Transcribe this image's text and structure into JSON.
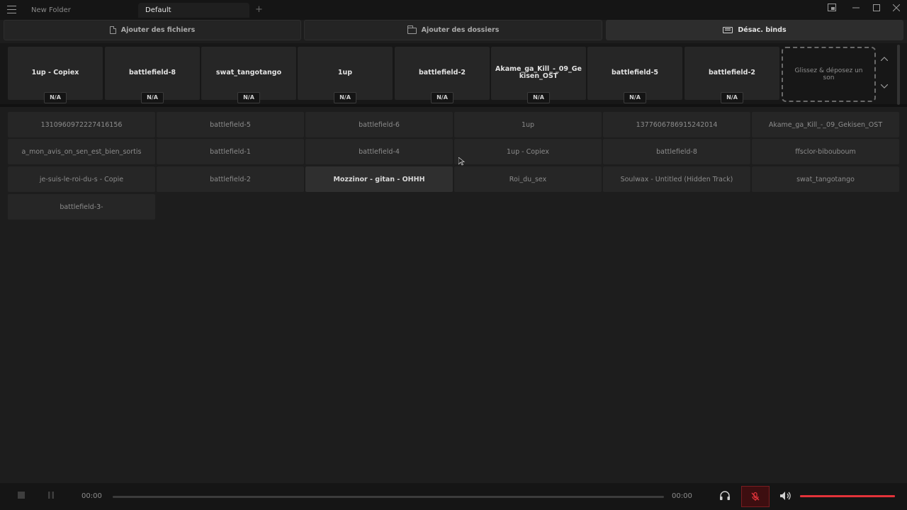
{
  "tabs": [
    {
      "label": "New Folder"
    },
    {
      "label": "Default"
    }
  ],
  "tab_add": "+",
  "actions": {
    "add_files": "Ajouter des fichiers",
    "add_folders": "Ajouter des dossiers",
    "disable_binds": "Désac. binds"
  },
  "bound_sounds": [
    {
      "name": "1up - Copiex",
      "key": "N/A"
    },
    {
      "name": "battlefield-8",
      "key": "N/A"
    },
    {
      "name": "swat_tangotango",
      "key": "N/A"
    },
    {
      "name": "1up",
      "key": "N/A"
    },
    {
      "name": "battlefield-2",
      "key": "N/A"
    },
    {
      "name": "Akame_ga_Kill_-_09_Gekisen_OST",
      "key": "N/A"
    },
    {
      "name": "battlefield-5",
      "key": "N/A"
    },
    {
      "name": "battlefield-2",
      "key": "N/A"
    }
  ],
  "dropzone_text": "Glissez & déposez un son",
  "library": [
    "1310960972227416156",
    "battlefield-5",
    "battlefield-6",
    "1up",
    "1377606786915242014",
    "Akame_ga_Kill_-_09_Gekisen_OST",
    "a_mon_avis_on_sen_est_bien_sortis",
    "battlefield-1",
    "battlefield-4",
    "1up - Copiex",
    "battlefield-8",
    "ffsclor-bibouboum",
    "je-suis-le-roi-du-s - Copie",
    "battlefield-2",
    "Mozzinor - gitan - OHHH",
    "Roi_du_sex",
    "Soulwax - Untitled (Hidden Track)",
    "swat_tangotango",
    "battlefield-3-"
  ],
  "library_hover_index": 14,
  "player": {
    "time_current": "00:00",
    "time_total": "00:00",
    "progress": 0,
    "volume": 1.0
  },
  "colors": {
    "accent": "#e3333a",
    "mic_muted_bg": "#3d0e10"
  }
}
